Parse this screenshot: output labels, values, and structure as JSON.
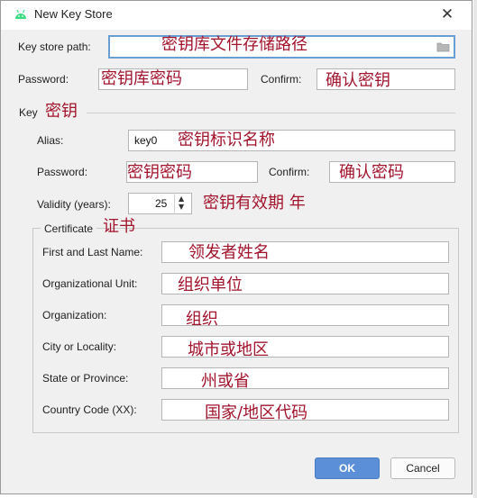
{
  "dialog": {
    "title": "New Key Store",
    "close_symbol": "✕"
  },
  "keystore": {
    "path_label": "Key store path:",
    "path_annotation": "密钥库文件存储路径",
    "password_label": "Password:",
    "password_annotation": "密钥库密码",
    "confirm_label": "Confirm:",
    "confirm_annotation": "确认密钥"
  },
  "key": {
    "section_label": "Key",
    "section_annotation": "密钥",
    "alias_label": "Alias:",
    "alias_value": "key0",
    "alias_annotation": "密钥标识名称",
    "password_label": "Password:",
    "password_annotation": "密钥密码",
    "confirm_label": "Confirm:",
    "confirm_annotation": "确认密码",
    "validity_label": "Validity (years):",
    "validity_value": "25",
    "validity_annotation": "密钥有效期 年"
  },
  "certificate": {
    "group_label": "Certificate",
    "group_annotation": "证书",
    "fields": [
      {
        "label": "First and Last Name:",
        "annotation": "领发者姓名"
      },
      {
        "label": "Organizational Unit:",
        "annotation": "组织单位"
      },
      {
        "label": "Organization:",
        "annotation": "组织"
      },
      {
        "label": "City or Locality:",
        "annotation": "城市或地区"
      },
      {
        "label": "State or Province:",
        "annotation": "州或省"
      },
      {
        "label": "Country Code (XX):",
        "annotation": "国家/地区代码"
      }
    ]
  },
  "buttons": {
    "ok": "OK",
    "cancel": "Cancel"
  },
  "icons": {
    "app": "android-icon",
    "browse": "folder-icon",
    "close": "close-icon",
    "spinner_up": "chevron-up-icon",
    "spinner_down": "chevron-down-icon"
  },
  "colors": {
    "annotation": "#a2132c",
    "ok_button": "#5b8fd8",
    "focus_border": "#6a9fd6",
    "android_green": "#3ddc84"
  }
}
